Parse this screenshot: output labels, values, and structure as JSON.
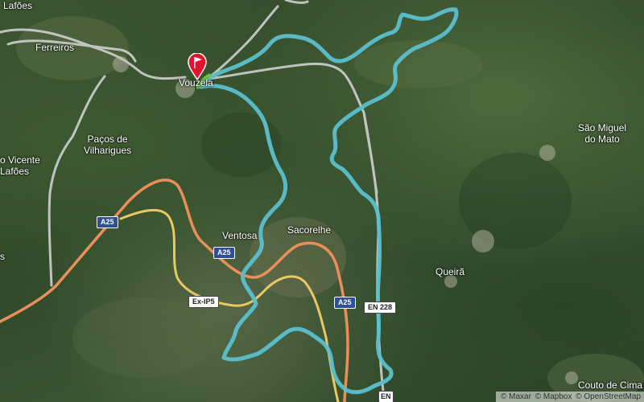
{
  "places": {
    "lafoes_top": "Lafões",
    "ferreiros": "Ferreiros",
    "vouzela": "Vouzela",
    "pacos_line1": "Paços de",
    "pacos_line2": "Vilharigues",
    "sao_vicente_line1": "o Vicente",
    "sao_vicente_line2": "Lafões",
    "ventosa": "Ventosa",
    "sacorelhe": "Sacorelhe",
    "queira": "Queirã",
    "sao_miguel_line1": "São Miguel",
    "sao_miguel_line2": "do Mato",
    "couto": "Couto de Cima",
    "left_edge": "s"
  },
  "road_shields": {
    "a25_left": "A25",
    "a25_center": "A25",
    "a25_right": "A25",
    "exip5": "Ex-IP5",
    "en228": "EN 228",
    "en_bottom": "EN"
  },
  "attribution": {
    "maxar": "© Maxar",
    "mapbox": "© Mapbox",
    "osm": "© OpenStreetMap"
  },
  "colors": {
    "route": "#5bc0cf",
    "motorway": "#e9905a",
    "trunk": "#e8c765",
    "minor_road": "#d9d9d9",
    "marker": "#e3122b"
  },
  "icons": {
    "start": "start-flag-marker-icon"
  }
}
